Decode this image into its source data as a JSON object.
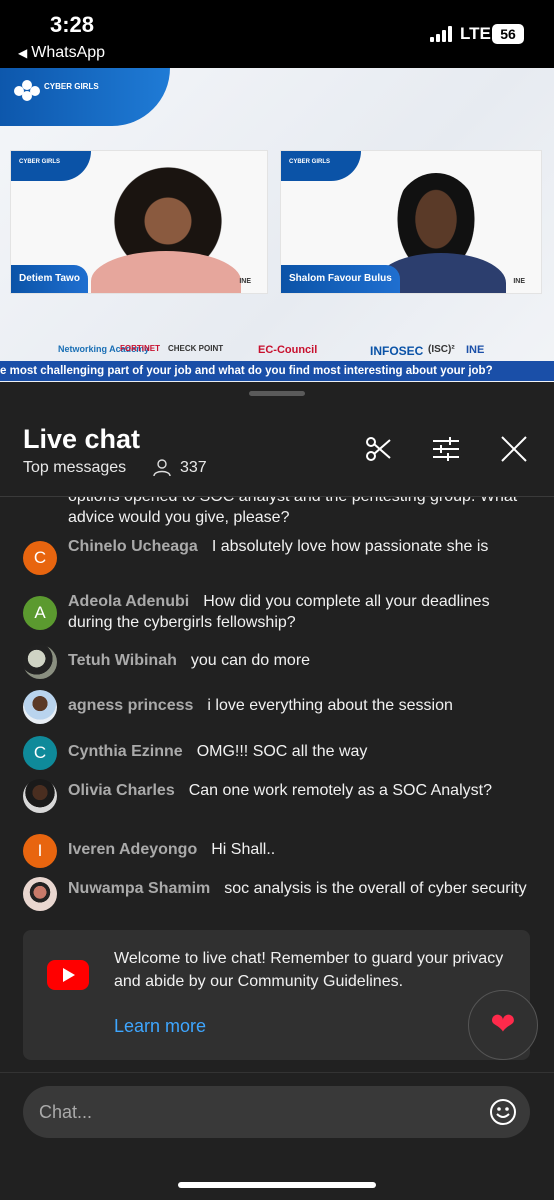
{
  "status_bar": {
    "time": "3:28",
    "back_label": "WhatsApp",
    "network": "LTE",
    "battery": "56"
  },
  "video": {
    "logo": "CYBER GIRLS",
    "speakers": [
      {
        "name": "Detiem Tawo"
      },
      {
        "name": "Shalom Favour Bulus"
      }
    ],
    "sponsors": [
      "Networking Academy",
      "FORTINET",
      "CHECK POINT",
      "EC-Council",
      "INFOSEC",
      "(ISC)²",
      "INE"
    ],
    "ticker": "e most challenging part of your job and what do you find most interesting about your job?"
  },
  "chat": {
    "title": "Live chat",
    "mode": "Top messages",
    "viewers": "337",
    "messages": [
      {
        "author": "",
        "text": "options opened to SOC analyst and the pentesting group. What advice would you give, please?"
      },
      {
        "author": "Chinelo Ucheaga",
        "initial": "C",
        "text": "I absolutely love how passionate she is"
      },
      {
        "author": "Adeola Adenubi",
        "initial": "A",
        "text": "How did you complete all your deadlines during the cybergirls fellowship?"
      },
      {
        "author": "Tetuh Wibinah",
        "initial": "",
        "text": "you can do more"
      },
      {
        "author": "agness princess",
        "initial": "",
        "text": "i love everything about the session"
      },
      {
        "author": "Cynthia Ezinne",
        "initial": "C",
        "text": "OMG!!! SOC all the way"
      },
      {
        "author": "Olivia Charles",
        "initial": "",
        "text": "Can one work remotely as a SOC Analyst?"
      },
      {
        "author": "Iveren Adeyongo",
        "initial": "I",
        "text": "Hi Shall.."
      },
      {
        "author": "Nuwampa Shamim",
        "initial": "",
        "text": "soc analysis is the overall of cyber security"
      }
    ],
    "welcome": "Welcome to live chat! Remember to guard your privacy and abide by our Community Guidelines.",
    "learn_more": "Learn more",
    "input_placeholder": "Chat..."
  },
  "colors": {
    "accent_link": "#3ea6ff",
    "avatar_orange": "#e8650f",
    "avatar_green": "#5b9a2f",
    "avatar_teal": "#0f8a9a",
    "youtube_red": "#ff0000"
  }
}
